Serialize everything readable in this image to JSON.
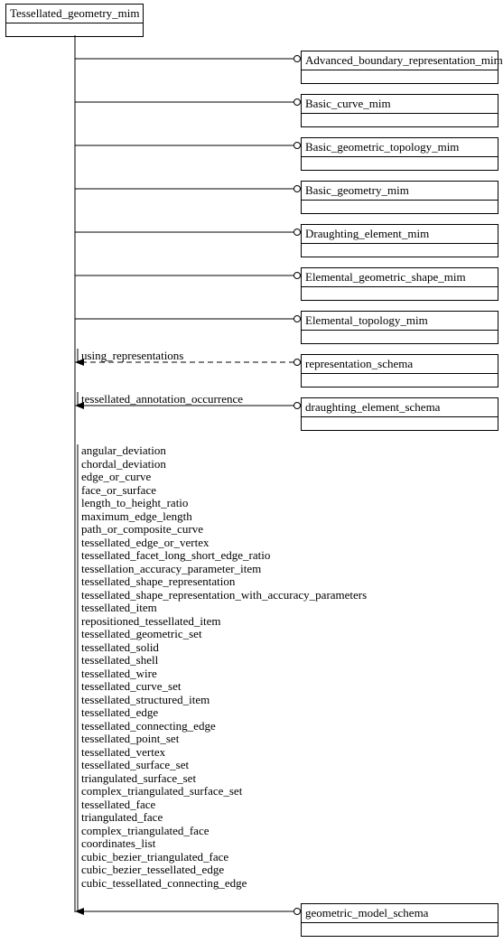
{
  "root_box": "Tessellated_geometry_mim",
  "targets": [
    {
      "label": "Advanced_boundary_representation_mim"
    },
    {
      "label": "Basic_curve_mim"
    },
    {
      "label": "Basic_geometric_topology_mim"
    },
    {
      "label": "Basic_geometry_mim"
    },
    {
      "label": "Draughting_element_mim"
    },
    {
      "label": "Elemental_geometric_shape_mim"
    },
    {
      "label": "Elemental_topology_mim"
    },
    {
      "label": "representation_schema",
      "conn_label": "using_representations"
    },
    {
      "label": "draughting_element_schema",
      "conn_label": "tessellated_annotation_occurrence"
    },
    {
      "label": "geometric_model_schema"
    }
  ],
  "terms": [
    "angular_deviation",
    "chordal_deviation",
    "edge_or_curve",
    "face_or_surface",
    "length_to_height_ratio",
    "maximum_edge_length",
    "path_or_composite_curve",
    "tessellated_edge_or_vertex",
    "tessellated_facet_long_short_edge_ratio",
    "tessellation_accuracy_parameter_item",
    "tessellated_shape_representation",
    "tessellated_shape_representation_with_accuracy_parameters",
    "tessellated_item",
    "repositioned_tessellated_item",
    "tessellated_geometric_set",
    "tessellated_solid",
    "tessellated_shell",
    "tessellated_wire",
    "tessellated_curve_set",
    "tessellated_structured_item",
    "tessellated_edge",
    "tessellated_connecting_edge",
    "tessellated_point_set",
    "tessellated_vertex",
    "tessellated_surface_set",
    "triangulated_surface_set",
    "complex_triangulated_surface_set",
    "tessellated_face",
    "triangulated_face",
    "complex_triangulated_face",
    "coordinates_list",
    "cubic_bezier_triangulated_face",
    "cubic_bezier_tessellated_edge",
    "cubic_tessellated_connecting_edge"
  ],
  "chart_data": {
    "type": "diagram",
    "description": "EXPRESS-G schema dependency diagram rooted at Tessellated_geometry_mim",
    "root": "Tessellated_geometry_mim",
    "references": [
      {
        "target": "Advanced_boundary_representation_mim",
        "style": "solid"
      },
      {
        "target": "Basic_curve_mim",
        "style": "solid"
      },
      {
        "target": "Basic_geometric_topology_mim",
        "style": "solid"
      },
      {
        "target": "Basic_geometry_mim",
        "style": "solid"
      },
      {
        "target": "Draughting_element_mim",
        "style": "solid"
      },
      {
        "target": "Elemental_geometric_shape_mim",
        "style": "solid"
      },
      {
        "target": "Elemental_topology_mim",
        "style": "solid"
      },
      {
        "target": "representation_schema",
        "style": "dashed",
        "label": "using_representations",
        "imports": [
          "using_representations"
        ]
      },
      {
        "target": "draughting_element_schema",
        "style": "solid",
        "label": "tessellated_annotation_occurrence",
        "imports": [
          "tessellated_annotation_occurrence"
        ]
      },
      {
        "target": "geometric_model_schema",
        "style": "solid",
        "imports": [
          "angular_deviation",
          "chordal_deviation",
          "edge_or_curve",
          "face_or_surface",
          "length_to_height_ratio",
          "maximum_edge_length",
          "path_or_composite_curve",
          "tessellated_edge_or_vertex",
          "tessellated_facet_long_short_edge_ratio",
          "tessellation_accuracy_parameter_item",
          "tessellated_shape_representation",
          "tessellated_shape_representation_with_accuracy_parameters",
          "tessellated_item",
          "repositioned_tessellated_item",
          "tessellated_geometric_set",
          "tessellated_solid",
          "tessellated_shell",
          "tessellated_wire",
          "tessellated_curve_set",
          "tessellated_structured_item",
          "tessellated_edge",
          "tessellated_connecting_edge",
          "tessellated_point_set",
          "tessellated_vertex",
          "tessellated_surface_set",
          "triangulated_surface_set",
          "complex_triangulated_surface_set",
          "tessellated_face",
          "triangulated_face",
          "complex_triangulated_face",
          "coordinates_list",
          "cubic_bezier_triangulated_face",
          "cubic_bezier_tessellated_edge",
          "cubic_tessellated_connecting_edge"
        ]
      }
    ]
  }
}
